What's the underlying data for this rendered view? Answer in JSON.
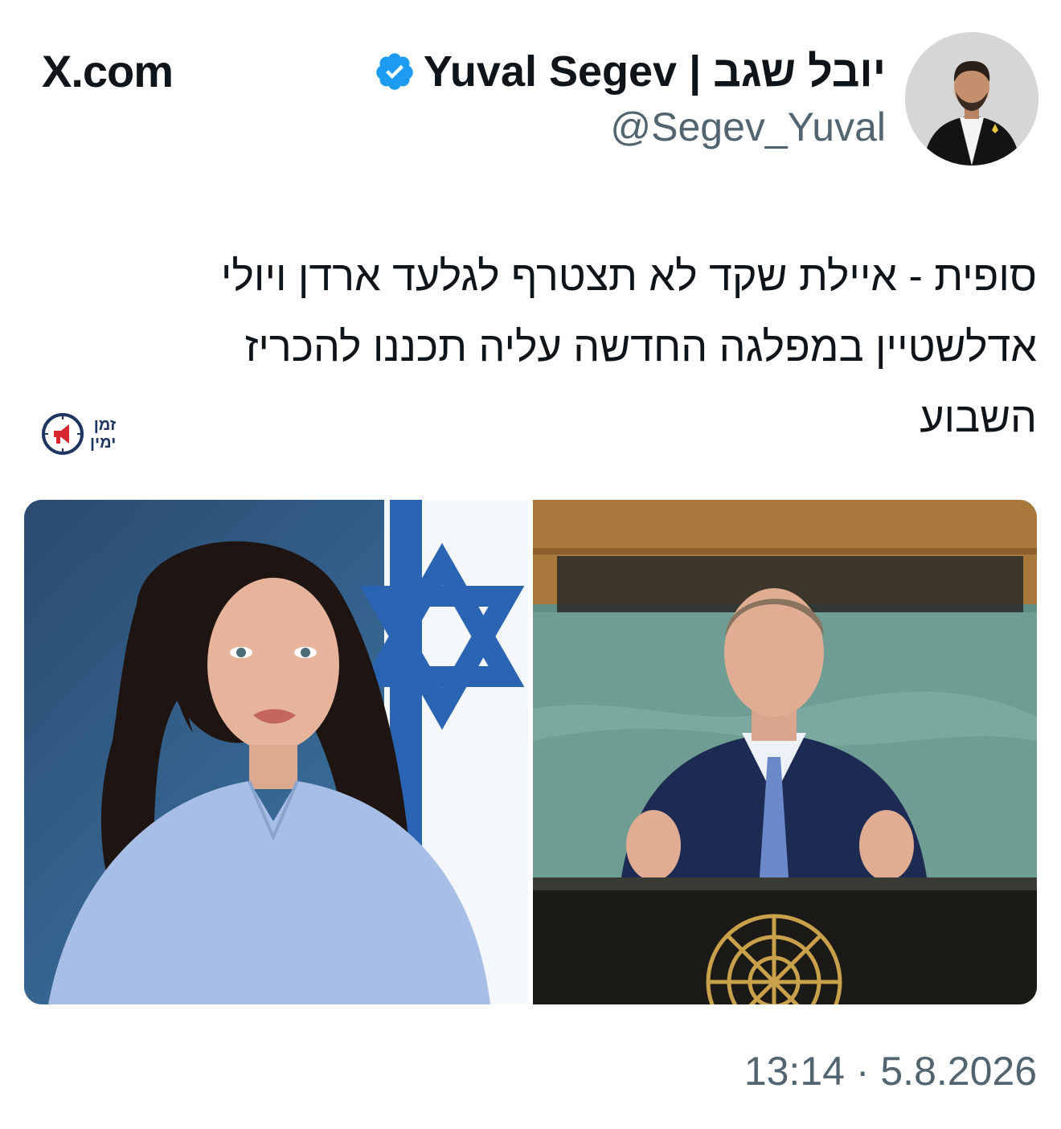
{
  "site": {
    "name": "X.com"
  },
  "author": {
    "display_name": "Yuval Segev | יובל שגב",
    "handle": "@Segev_Yuval",
    "verified": true,
    "avatar_icon": "profile-photo"
  },
  "tweet": {
    "text_lines": [
      "סופית - איילת שקד לא תצטרף לגלעד ארדן ויולי",
      "אדלשטיין במפלגה החדשה עליה תכננו להכריז",
      "השבוע"
    ],
    "watermark": {
      "line1": "זמן",
      "line2": "ימין"
    },
    "timestamp": "13:14 · 5.8.2026"
  },
  "colors": {
    "text": "#0f1419",
    "secondary_text": "#536471",
    "verified_blue": "#1d9bf0"
  }
}
